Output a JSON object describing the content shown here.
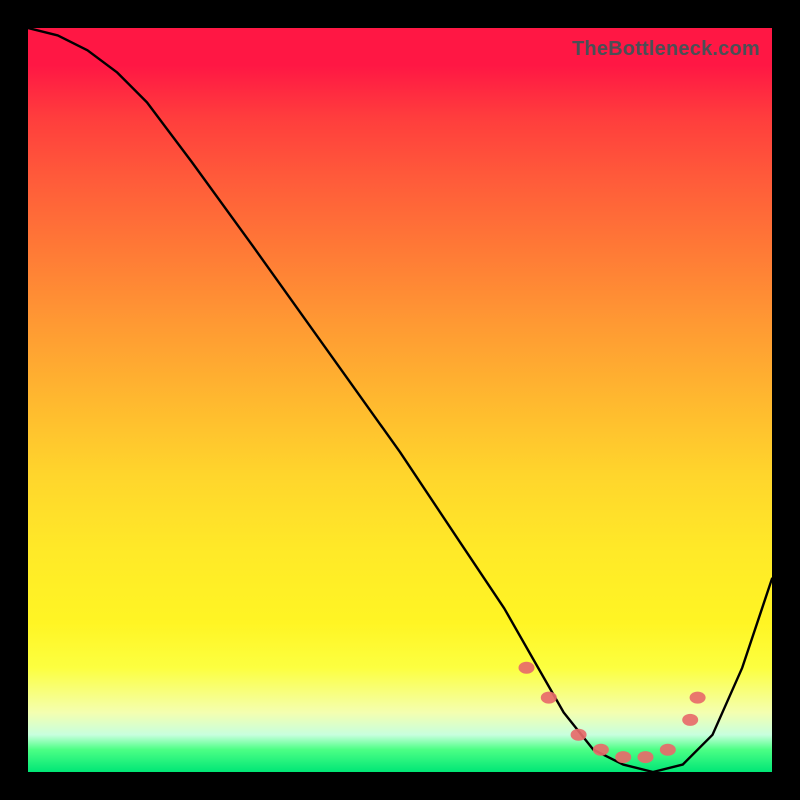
{
  "watermark": "TheBottleneck.com",
  "chart_data": {
    "type": "line",
    "title": "",
    "xlabel": "",
    "ylabel": "",
    "xlim": [
      0,
      100
    ],
    "ylim": [
      0,
      100
    ],
    "series": [
      {
        "name": "curve",
        "x": [
          0,
          4,
          8,
          12,
          16,
          22,
          30,
          40,
          50,
          58,
          64,
          68,
          72,
          76,
          80,
          84,
          88,
          92,
          96,
          100
        ],
        "y": [
          100,
          99,
          97,
          94,
          90,
          82,
          71,
          57,
          43,
          31,
          22,
          15,
          8,
          3,
          1,
          0,
          1,
          5,
          14,
          26
        ]
      }
    ],
    "markers": {
      "name": "highlight-points",
      "color": "#e76a6a",
      "x": [
        67,
        70,
        74,
        77,
        80,
        83,
        86,
        89,
        90
      ],
      "y": [
        14,
        10,
        5,
        3,
        2,
        2,
        3,
        7,
        10
      ]
    },
    "gradient_stops": [
      {
        "pos": 0,
        "color": "#ff1744"
      },
      {
        "pos": 30,
        "color": "#ff7a36"
      },
      {
        "pos": 60,
        "color": "#ffd52c"
      },
      {
        "pos": 85,
        "color": "#fcff40"
      },
      {
        "pos": 97,
        "color": "#4cff85"
      },
      {
        "pos": 100,
        "color": "#00e676"
      }
    ]
  }
}
